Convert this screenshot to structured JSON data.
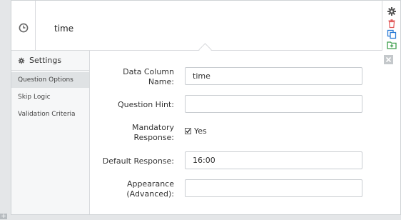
{
  "question": {
    "title": "time",
    "icon": "clock-icon"
  },
  "toolbar": {
    "icons": [
      "gear-icon",
      "trash-icon",
      "copy-icon",
      "folder-add-icon",
      "close-icon"
    ],
    "accent_colors": {
      "trash": "#e15b5b",
      "copy": "#2a7bd6",
      "folder": "#3c9d4a"
    }
  },
  "sidebar": {
    "title": "Settings",
    "items": [
      {
        "label": "Question Options",
        "active": true
      },
      {
        "label": "Skip Logic",
        "active": false
      },
      {
        "label": "Validation Criteria",
        "active": false
      }
    ]
  },
  "form": {
    "data_column_label_line1": "Data Column",
    "data_column_label_line2": "Name:",
    "data_column_value": "time",
    "hint_label": "Question Hint:",
    "hint_value": "",
    "mandatory_label_line1": "Mandatory",
    "mandatory_label_line2": "Response:",
    "mandatory_checked": true,
    "mandatory_option": "Yes",
    "default_label": "Default Response:",
    "default_value": "16:00",
    "appearance_label_line1": "Appearance",
    "appearance_label_line2": "(Advanced):",
    "appearance_value": ""
  },
  "corner_button": "+"
}
